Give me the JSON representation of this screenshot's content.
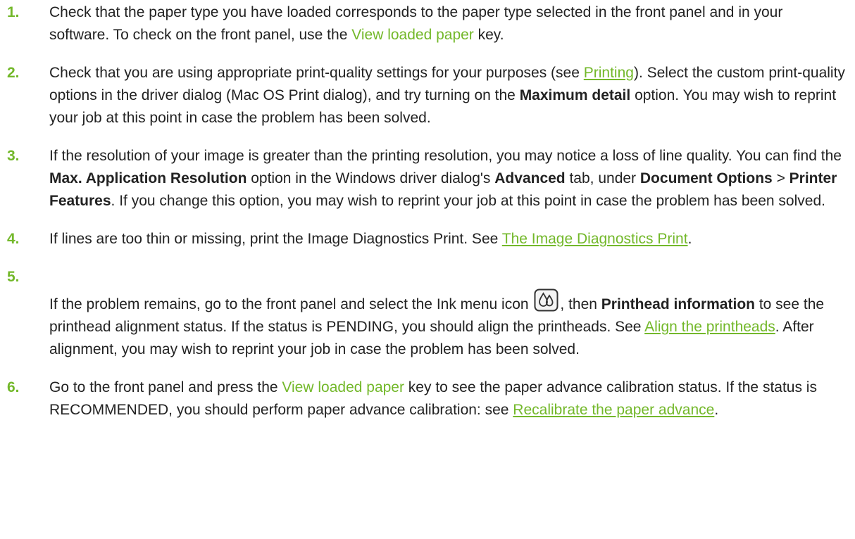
{
  "steps": [
    {
      "num": "1.",
      "parts": {
        "t1": "Check that the paper type you have loaded corresponds to the paper type selected in the front panel and in your software. To check on the front panel, use the ",
        "key1": "View loaded paper",
        "t2": " key."
      }
    },
    {
      "num": "2.",
      "parts": {
        "t1": "Check that you are using appropriate print-quality settings for your purposes (see ",
        "link1": "Printing",
        "t2": "). Select the custom print-quality options in the driver dialog (Mac OS Print dialog), and try turning on the ",
        "b1": "Maximum detail",
        "t3": " option. You may wish to reprint your job at this point in case the problem has been solved."
      }
    },
    {
      "num": "3.",
      "parts": {
        "t1": "If the resolution of your image is greater than the printing resolution, you may notice a loss of line quality. You can find the ",
        "b1": "Max. Application Resolution",
        "t2": " option in the Windows driver dialog's ",
        "b2": "Advanced",
        "t3": " tab, under ",
        "b3": "Document Options",
        "t4": " > ",
        "b4": "Printer Features",
        "t5": ". If you change this option, you may wish to reprint your job at this point in case the problem has been solved."
      }
    },
    {
      "num": "4.",
      "parts": {
        "t1": "If lines are too thin or missing, print the Image Diagnostics Print. See ",
        "link1": "The Image Diagnostics Print",
        "t2": "."
      }
    },
    {
      "num": "5.",
      "parts": {
        "t1": "If the problem remains, go to the front panel and select the Ink menu icon ",
        "t2": ", then ",
        "b1": "Printhead information",
        "t3": " to see the printhead alignment status. If the status is PENDING, you should align the printheads. See ",
        "link1": "Align the printheads",
        "t4": ". After alignment, you may wish to reprint your job in case the problem has been solved."
      },
      "icon": "ink-menu-icon"
    },
    {
      "num": "6.",
      "parts": {
        "t1": "Go to the front panel and press the ",
        "key1": "View loaded paper",
        "t2": " key to see the paper advance calibration status. If the status is RECOMMENDED, you should perform paper advance calibration: see ",
        "link1": "Recalibrate the paper advance",
        "t3": "."
      }
    }
  ],
  "colors": {
    "accent": "#73b82a",
    "text": "#222222"
  }
}
